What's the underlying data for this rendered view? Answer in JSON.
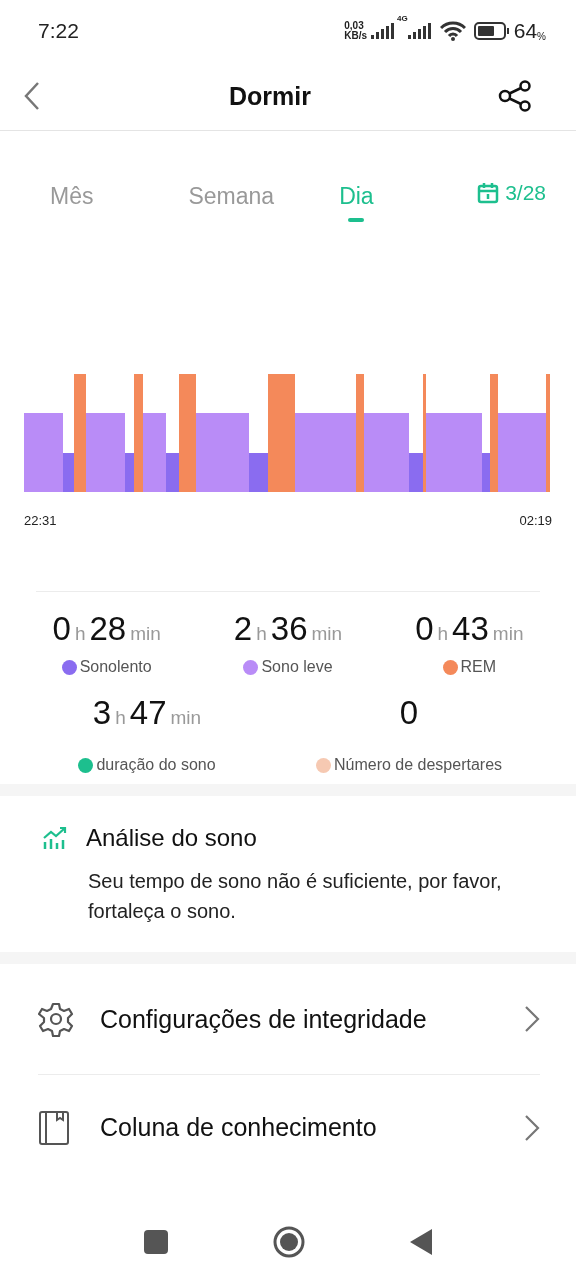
{
  "status_bar": {
    "time": "7:22",
    "net_speed": "0,03",
    "net_unit": "KB/s",
    "network": "4G",
    "battery": "64",
    "battery_unit": "%"
  },
  "header": {
    "title": "Dormir"
  },
  "tabs": [
    {
      "label": "Mês",
      "selected": false
    },
    {
      "label": "Semana",
      "selected": false
    },
    {
      "label": "Dia",
      "selected": true
    }
  ],
  "date": "3/28",
  "chart": {
    "start": "22:31",
    "end": "02:19"
  },
  "stats": [
    {
      "kind": "duration",
      "hours": "0",
      "hours_unit": "h",
      "minutes": "28",
      "minutes_unit": "min",
      "label": "Sonolento",
      "color": "#8a6cf0"
    },
    {
      "kind": "duration",
      "hours": "2",
      "hours_unit": "h",
      "minutes": "36",
      "minutes_unit": "min",
      "label": "Sono leve",
      "color": "#b98cf7"
    },
    {
      "kind": "duration",
      "hours": "0",
      "hours_unit": "h",
      "minutes": "43",
      "minutes_unit": "min",
      "label": "REM",
      "color": "#f4895a"
    },
    {
      "kind": "duration",
      "hours": "3",
      "hours_unit": "h",
      "minutes": "47",
      "minutes_unit": "min",
      "label": "duração do sono",
      "color": "#1dbf8e"
    },
    {
      "kind": "count",
      "value": "0",
      "label": "Número de despertares",
      "color": "#f6c9b2"
    }
  ],
  "analysis": {
    "title": "Análise do sono",
    "text": "Seu tempo de sono não é suficiente, por favor, fortaleça o sono."
  },
  "menu": [
    {
      "label": "Configurações de integridade"
    },
    {
      "label": "Coluna de conhecimento"
    }
  ]
}
